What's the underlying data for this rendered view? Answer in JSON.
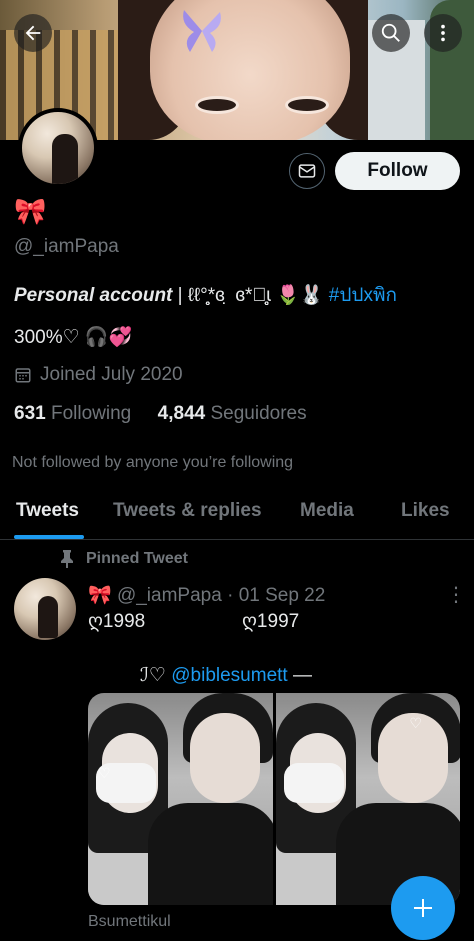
{
  "header": {
    "back_label": "Back",
    "colors": {
      "accent": "#1d9bf0",
      "background": "#000000",
      "muted": "#71767b"
    }
  },
  "profile": {
    "name_emoji": "🎀",
    "handle": "@_iamPapa",
    "follow_label": "Follow",
    "bio_line1_bold": "Personal account",
    "bio_line1_sep": " | ",
    "bio_line1_deco": "ℓℓ°̥̥̥̥̥̥̥̥*ɞ ̣ ɞ*ﾟ̥̥̥̥̥̥̥̥ɩ 🌷🐰 ",
    "bio_line1_tag": "#ปปxพิก",
    "bio_line2": "300%♡ 🎧💞",
    "joined": "Joined July 2020",
    "following_count": "631",
    "following_label": "Following",
    "followers_count": "4,844",
    "followers_label": "Seguidores",
    "not_followed": "Not followed by anyone you’re following"
  },
  "tabs": [
    {
      "label": "Tweets",
      "active": true
    },
    {
      "label": "Tweets & replies",
      "active": false
    },
    {
      "label": "Media",
      "active": false
    },
    {
      "label": "Likes",
      "active": false
    }
  ],
  "tweet": {
    "pinned_label": "Pinned Tweet",
    "author_emoji": "🎀",
    "author_handle": "@_iamPapa",
    "dot": "·",
    "date": "01 Sep 22",
    "text_left": "ღ1998",
    "text_right": "ღ1997",
    "mention_prefix": "ℐ♡ ",
    "mention": "@biblesumett",
    "mention_suffix": " —",
    "caption": "Bsumettikul"
  }
}
